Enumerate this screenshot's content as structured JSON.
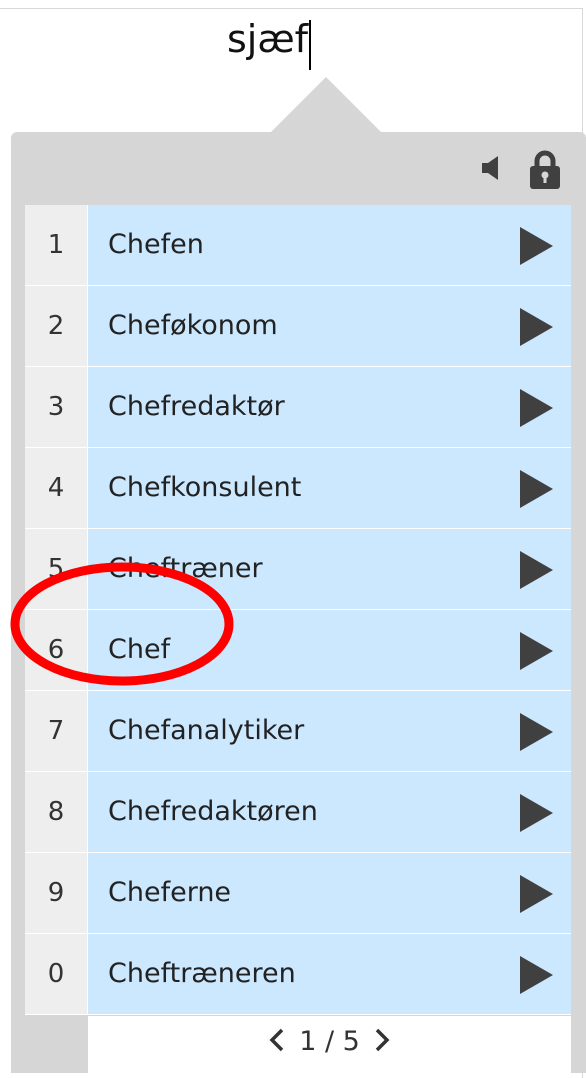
{
  "editor": {
    "typed_text": "sjæf"
  },
  "toolbar": {
    "speaker_icon": "speaker-icon",
    "lock_icon": "lock-icon"
  },
  "candidates": [
    {
      "index": "1",
      "text": "Chefen"
    },
    {
      "index": "2",
      "text": "Cheføkonom"
    },
    {
      "index": "3",
      "text": "Chefredaktør"
    },
    {
      "index": "4",
      "text": "Chefkonsulent"
    },
    {
      "index": "5",
      "text": "Cheftræner"
    },
    {
      "index": "6",
      "text": "Chef"
    },
    {
      "index": "7",
      "text": "Chefanalytiker"
    },
    {
      "index": "8",
      "text": "Chefredaktøren"
    },
    {
      "index": "9",
      "text": "Cheferne"
    },
    {
      "index": "0",
      "text": "Cheftræneren"
    }
  ],
  "pager": {
    "text": "1 / 5"
  },
  "colors": {
    "panel_bg": "#d6d6d6",
    "candidate_bg": "#cce8ff",
    "number_bg": "#eeeeee",
    "annotation_circle": "#ff0000"
  }
}
